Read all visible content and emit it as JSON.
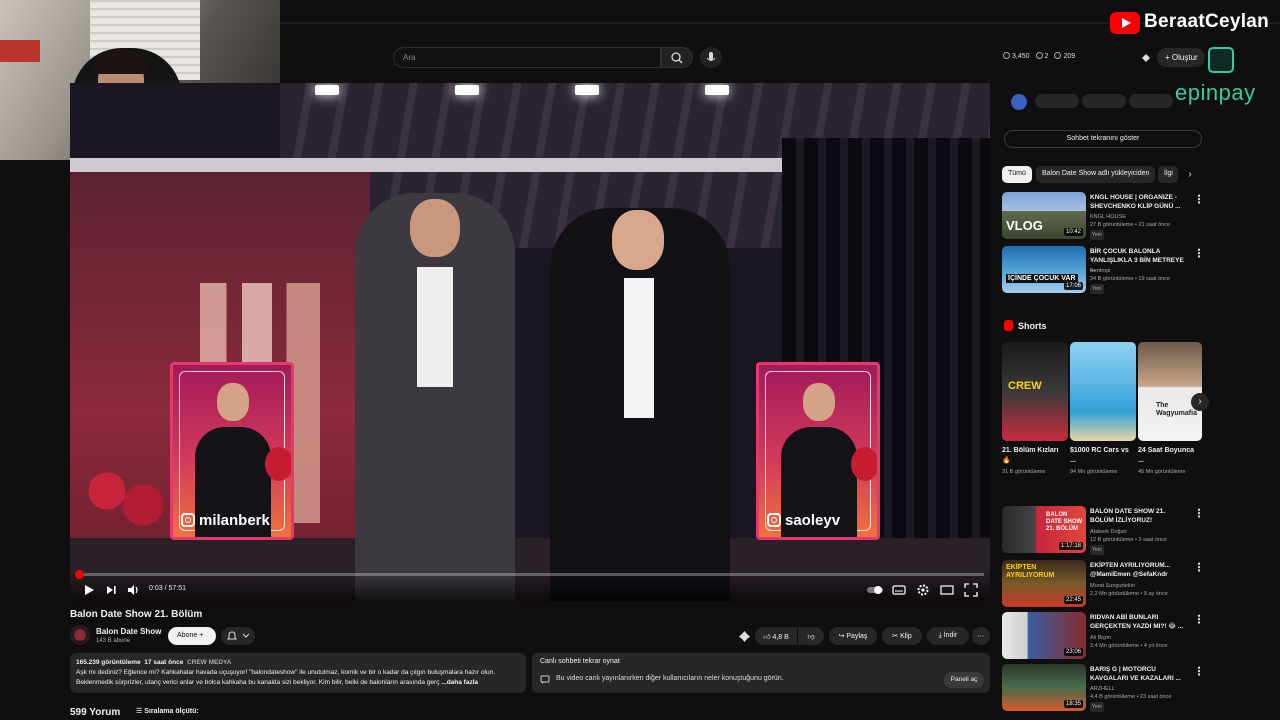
{
  "streamer": {
    "name": "BeraatCeylan",
    "sponsor": "epinpay"
  },
  "search": {
    "placeholder": "Ara"
  },
  "header_stats": {
    "views": "3,450",
    "likes": "2",
    "coins": "209"
  },
  "header": {
    "create_label": "Oluştur"
  },
  "video": {
    "title": "Balon Date Show 21. Bölüm",
    "time": "0:03 / 57:51",
    "progress_fraction": 0.001,
    "card_left_handle": "milanberk",
    "card_right_handle": "saoleyv"
  },
  "channel": {
    "name": "Balon Date Show",
    "subscribers": "143 B abone",
    "subscribe_label": "Abone"
  },
  "actions": {
    "likes": "4,8 B",
    "share": "Paylaş",
    "clip": "Klip",
    "download": "İndir"
  },
  "description": {
    "views": "165.239 görüntüleme",
    "age": "17 saat önce",
    "tag": "CREW MEDYA",
    "text": "Aşk mı dediniz? Eğlence mi? Kahkahalar havada uçuşuyor! \"balondateshow\" ile unutulmaz, komik ve bir o kadar da çılgın buluşmalara hazır olun. Beklenmedik sürprizler, utanç verici anlar ve bolca kahkaha bu kanalda sizi bekliyor. Kim bilir, belki de balonların arasında gerç",
    "more": "...daha fazla"
  },
  "live_replay": {
    "title": "Canlı sohbeti tekrar oynat",
    "text": "Bu video canlı yayınlanırken diğer kullanıcıların neler konuştuğunu görün.",
    "button": "Paneli aç"
  },
  "comments": {
    "count": "599 Yorum",
    "sort_label": "Sıralama ölçütü:"
  },
  "sidebar": {
    "chat_show": "Sohbet tekranını göster",
    "chips": [
      "Tümü",
      "Balon Date Show adlı yükleyiciden",
      "İlgi"
    ],
    "top_videos": [
      {
        "title": "KNGL HOUSE | ORGANIZE - SHEVCHENKO KLİP GÜNÜ ...",
        "channel": "KNGL HOUSE",
        "meta": "27 B görüntüleme • 21 saat önce",
        "badge": "Yeni",
        "duration": "10:42",
        "thumb_text": "VLOG"
      },
      {
        "title": "BİR ÇOCUK BALONLA YANLIŞLIKLA 3 BİN METREYE ...",
        "channel": "Bentropi",
        "meta": "34 B görüntüleme • 19 saat önce",
        "badge": "Yeni",
        "duration": "17:06",
        "thumb_text": "İÇİNDE ÇOCUK VAR"
      }
    ],
    "shorts_label": "Shorts",
    "shorts": [
      {
        "title": "21. Bölüm Kızları 🔥",
        "meta": "31 B görüntüleme",
        "thumb_text": "CREW"
      },
      {
        "title": "$1000 RC Cars vs ...",
        "meta": "94 Mn görüntüleme",
        "thumb_text": ""
      },
      {
        "title": "24 Saat Boyunca ...",
        "meta": "45 Mn görüntüleme",
        "thumb_text": "The Wagyumafia"
      }
    ],
    "bottom_videos": [
      {
        "title": "BALON DATE SHOW 21. BÖLÜM İZLİYORUZ!",
        "channel": "Ataberk Doğan",
        "meta": "12 B görüntüleme • 3 saat önce",
        "badge": "Yeni",
        "duration": "1:17:18",
        "thumb_text": "BALON DATE SHOW 21. BÖLÜM"
      },
      {
        "title": "EKİPTEN AYRILIYORUM... @MamiEmen @SefaKndr",
        "channel": "Murat Sungurtekin",
        "meta": "2,2 Mn görüntüleme • 9 ay önce",
        "badge": "",
        "duration": "22:45",
        "thumb_text": "EKİPTEN AYRILIYORUM"
      },
      {
        "title": "RIDVAN ABİ BUNLARI GERÇEKTEN YAZDI MI?! 😂 ...",
        "channel": "Ali Biçim",
        "meta": "3,4 Mn görüntüleme • 4 yıl önce",
        "badge": "",
        "duration": "23:06",
        "thumb_text": ""
      },
      {
        "title": "BARIŞ G | MOTORCU KAVGALARI VE KAZALARI ...",
        "channel": "ARZHELL",
        "meta": "4,4 B görüntüleme • 23 saat önce",
        "badge": "Yeni",
        "duration": "18:35",
        "thumb_text": ""
      }
    ]
  },
  "colors": {
    "accent": "#ff0000",
    "background": "#0f0f0f",
    "surface": "#272727",
    "epin": "#38c9a6"
  },
  "icons": [
    "search-icon",
    "mic-icon",
    "plus-icon",
    "bell-icon",
    "like-icon",
    "dislike-icon",
    "share-icon",
    "clip-icon",
    "download-icon",
    "more-icon",
    "play-icon",
    "next-icon",
    "volume-icon",
    "settings-icon",
    "fullscreen-icon",
    "chat-icon",
    "sort-icon",
    "shorts-icon"
  ]
}
